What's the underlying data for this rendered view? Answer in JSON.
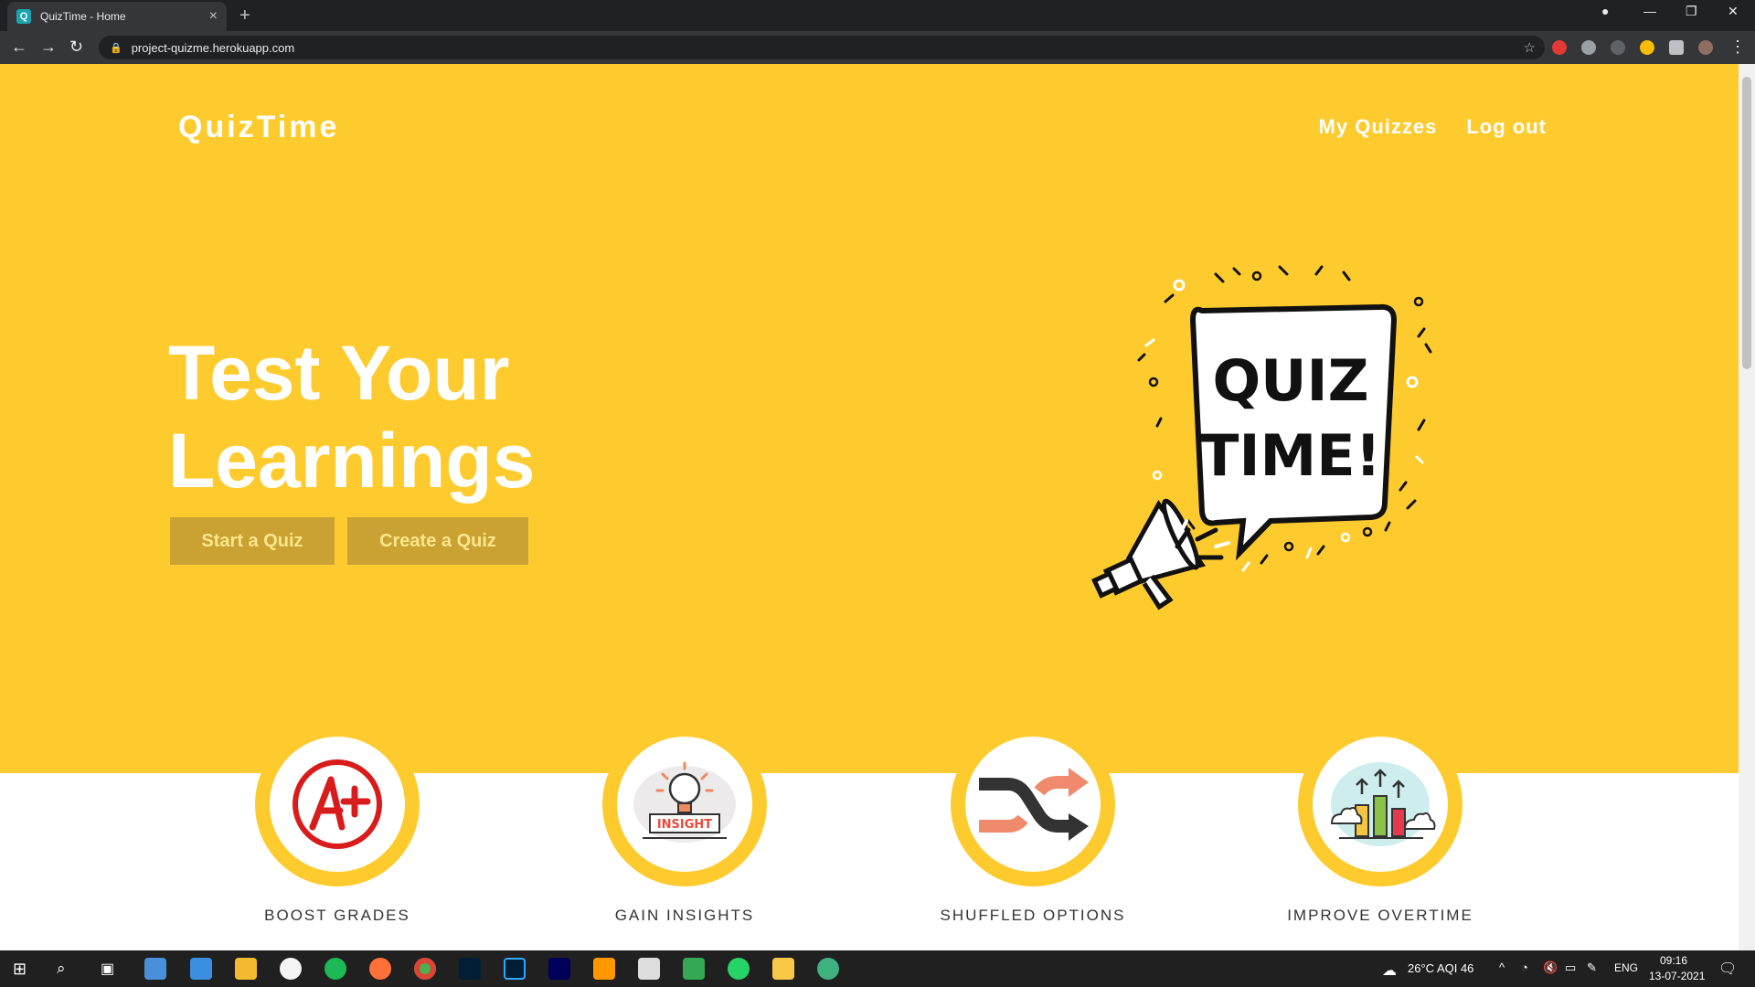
{
  "browser": {
    "tab_title": "QuizTime - Home",
    "url": "project-quizme.herokuapp.com"
  },
  "site": {
    "brand": "QuizTime",
    "nav": {
      "my_quizzes": "My Quizzes",
      "logout": "Log out"
    },
    "headline_line1": "Test Your",
    "headline_line2": "Learnings",
    "start_button": "Start a Quiz",
    "create_button": "Create a Quiz",
    "illustration": {
      "line1": "QUIZ",
      "line2": "TIME!"
    },
    "features": [
      {
        "label": "BOOST GRADES",
        "icon": "grade-a-plus-icon"
      },
      {
        "label": "GAIN INSIGHTS",
        "icon": "insight-bulb-icon"
      },
      {
        "label": "SHUFFLED OPTIONS",
        "icon": "shuffle-icon"
      },
      {
        "label": "IMPROVE OVERTIME",
        "icon": "growth-chart-icon"
      }
    ],
    "colors": {
      "accent": "#fecb2e",
      "button": "#c9a233",
      "button_text": "#fde58a"
    }
  },
  "taskbar": {
    "weather": "26°C  AQI 46",
    "language": "ENG",
    "time": "09:16",
    "date": "13-07-2021"
  }
}
